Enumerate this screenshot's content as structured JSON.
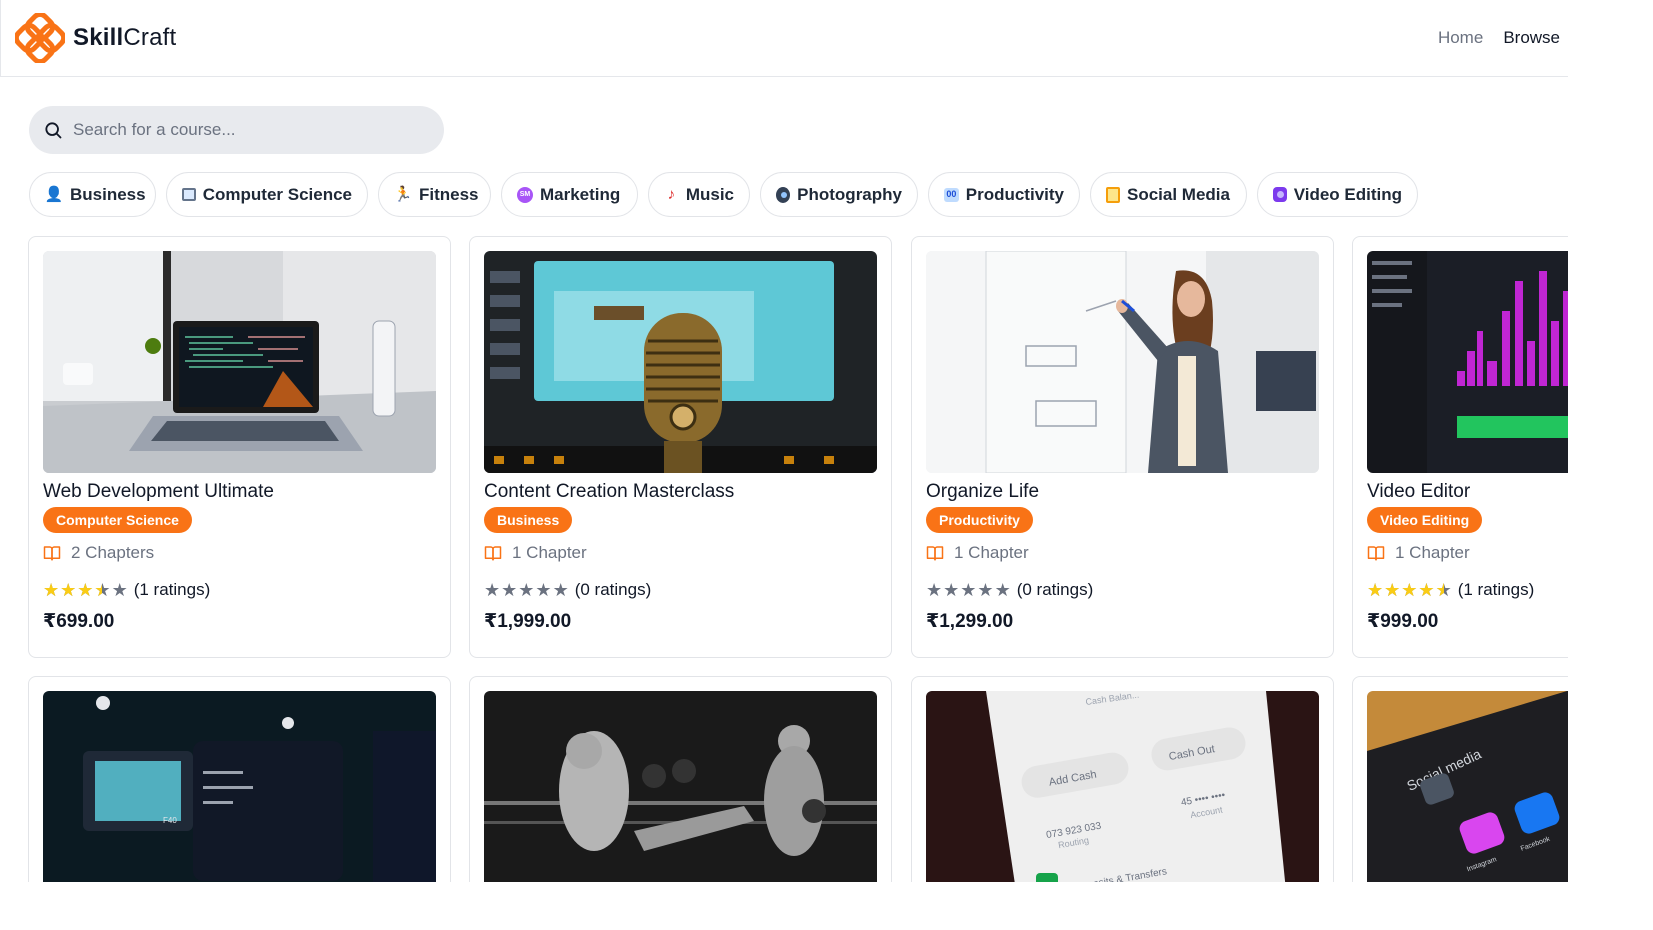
{
  "brand": {
    "name_bold": "Skill",
    "name_regular": "Craft",
    "color": "#f97316"
  },
  "nav": {
    "links": [
      {
        "label": "Home",
        "active": false
      },
      {
        "label": "Browse",
        "active": true
      }
    ]
  },
  "search": {
    "placeholder": "Search for a course...",
    "value": ""
  },
  "categories": [
    {
      "label": "Business",
      "icon": "person-icon"
    },
    {
      "label": "Computer Science",
      "icon": "computer-icon"
    },
    {
      "label": "Fitness",
      "icon": "runner-icon"
    },
    {
      "label": "Marketing",
      "icon": "sm-badge-icon"
    },
    {
      "label": "Music",
      "icon": "music-note-icon"
    },
    {
      "label": "Photography",
      "icon": "film-reel-icon"
    },
    {
      "label": "Productivity",
      "icon": "infinity-icon"
    },
    {
      "label": "Social Media",
      "icon": "book-icon"
    },
    {
      "label": "Video Editing",
      "icon": "camera-icon"
    }
  ],
  "courses": [
    {
      "title": "Web Development Ultimate",
      "category": "Computer Science",
      "chapters": "2 Chapters",
      "rating": 3.5,
      "ratings_text": "(1 ratings)",
      "price": "₹699.00"
    },
    {
      "title": "Content Creation Masterclass",
      "category": "Business",
      "chapters": "1 Chapter",
      "rating": 0,
      "ratings_text": "(0 ratings)",
      "price": "₹1,999.00"
    },
    {
      "title": "Organize Life",
      "category": "Productivity",
      "chapters": "1 Chapter",
      "rating": 0,
      "ratings_text": "(0 ratings)",
      "price": "₹1,299.00"
    },
    {
      "title": "Video Editor",
      "category": "Video Editing",
      "chapters": "1 Chapter",
      "rating": 4.5,
      "ratings_text": "(1 ratings)",
      "price": "₹999.00"
    }
  ],
  "thumbnail_text": {
    "cash_balance": "Cash Balan...",
    "add_cash": "Add Cash",
    "cash_out": "Cash Out",
    "routing_number": "073 923 033",
    "routing_label": "Routing",
    "account_number": "45 •••• ••••",
    "account_label": "Account",
    "deposits": "Deposits & Transfers",
    "social_media": "Social media",
    "instagram": "Instagram",
    "facebook": "Facebook",
    "camera_label": "F40"
  }
}
